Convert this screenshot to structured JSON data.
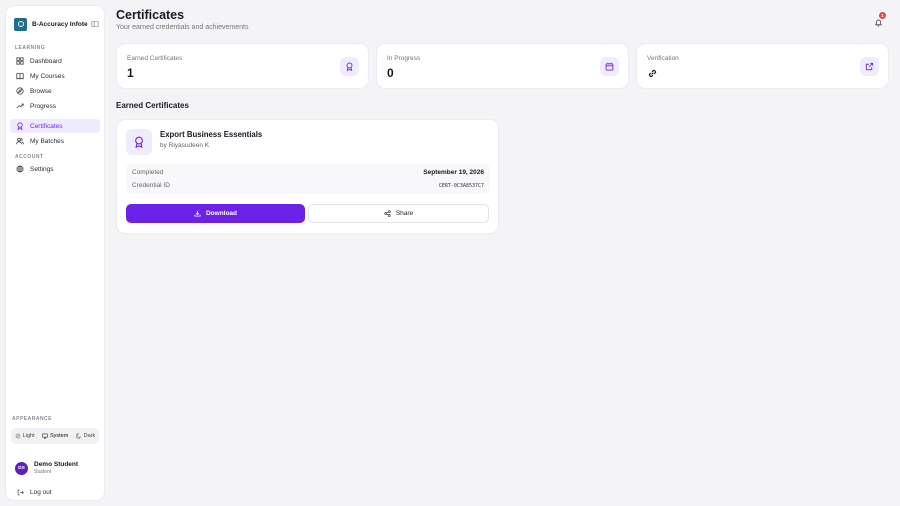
{
  "colors": {
    "accent": "#6b21e8",
    "accent_soft": "#f1ebff",
    "badge": "#e64545"
  },
  "brand": {
    "name": "B-Accuracy Infote...",
    "logo_icon": "brand-logo-icon",
    "toggle_icon": "sidebar-toggle-icon"
  },
  "sidebar": {
    "learning_label": "LEARNING",
    "items": [
      {
        "label": "Dashboard",
        "icon": "grid-icon",
        "active": false
      },
      {
        "label": "My Courses",
        "icon": "book-icon",
        "active": false
      },
      {
        "label": "Browse",
        "icon": "compass-icon",
        "active": false
      },
      {
        "label": "Progress",
        "icon": "trending-icon",
        "active": false
      },
      {
        "label": "Certificates",
        "icon": "award-icon",
        "active": true
      },
      {
        "label": "My Batches",
        "icon": "users-icon",
        "active": false
      }
    ],
    "account_label": "ACCOUNT",
    "account_items": [
      {
        "label": "Settings",
        "icon": "gear-icon"
      }
    ],
    "appearance_label": "APPEARANCE",
    "theme": {
      "light": "Light",
      "system": "System",
      "dark": "Dark",
      "selected": "System"
    },
    "user": {
      "initials": "DS",
      "name": "Demo Student",
      "role": "Student"
    },
    "logout_label": "Log out"
  },
  "header": {
    "title": "Certificates",
    "subtitle": "Your earned credentials and achievements",
    "notification_count": "1"
  },
  "stats": [
    {
      "label": "Earned Certificates",
      "value": "1",
      "icon": "award-icon"
    },
    {
      "label": "In Progress",
      "value": "0",
      "icon": "calendar-icon"
    },
    {
      "label": "Verification",
      "value": "",
      "icon": "external-link-icon"
    }
  ],
  "earned_section_title": "Earned Certificates",
  "certificate": {
    "title": "Export Business Essentials",
    "author": "by Riyasudeen K",
    "completed_label": "Completed",
    "completed_value": "September 19, 2026",
    "credential_label": "Credential ID",
    "credential_value": "CERT-0C3A8537C7",
    "download_label": "Download",
    "share_label": "Share"
  }
}
